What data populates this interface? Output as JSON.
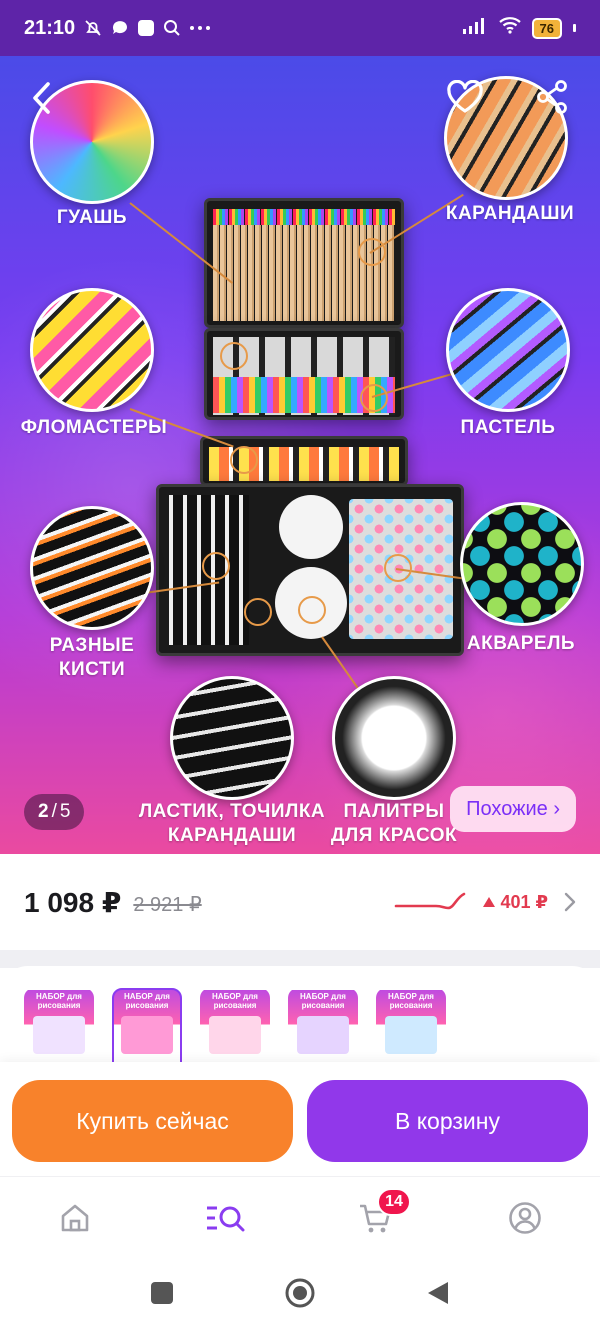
{
  "status_bar": {
    "time": "21:10",
    "icons": [
      "bell-muted-icon",
      "chat-bubble-icon",
      "square-app-icon",
      "search-icon",
      "more-dots-icon"
    ],
    "right_icons": [
      "signal-icon",
      "wifi-icon",
      "battery-icon"
    ],
    "battery_level": "76"
  },
  "gallery": {
    "current": "2",
    "separator": "/",
    "total": "5",
    "similar_label": "Похожие ›",
    "labels": {
      "gouache": "ГУАШЬ",
      "pencils": "КАРАНДАШИ",
      "markers": "ФЛОМАСТЕРЫ",
      "pastel": "ПАСТЕЛЬ",
      "brushes": "РАЗНЫЕ\nКИСТИ",
      "watercolor": "АКВАРЕЛЬ",
      "eraser": "ЛАСТИК, ТОЧИЛКА\nКАРАНДАШИ",
      "palettes": "ПАЛИТРЫ\nДЛЯ КРАСОК"
    }
  },
  "price": {
    "current": "1 098 ₽",
    "old": "2 921 ₽",
    "delta": "401 ₽",
    "trend_color": "#e23a4f"
  },
  "variants": [
    {
      "title": "НАБОР для рисования",
      "pic": "#f0e2ff"
    },
    {
      "title": "НАБОР для рисования",
      "pic": "#ff9ad6"
    },
    {
      "title": "НАБОР для рисования",
      "pic": "#ffd6ea"
    },
    {
      "title": "НАБОР для рисования",
      "pic": "#e6d4ff"
    },
    {
      "title": "НАБОР для рисования",
      "pic": "#cfeaff"
    }
  ],
  "actions": {
    "buy_now": "Купить сейчас",
    "add_to_cart": "В корзину"
  },
  "bottom_nav": {
    "items": [
      "home-icon",
      "catalog-search-icon",
      "cart-icon",
      "profile-icon"
    ],
    "cart_badge": "14",
    "active_color": "#8a3cf0"
  },
  "colors": {
    "status_bar": "#5e24a8",
    "buy_button": "#f8822b",
    "cart_button": "#9138ea"
  }
}
